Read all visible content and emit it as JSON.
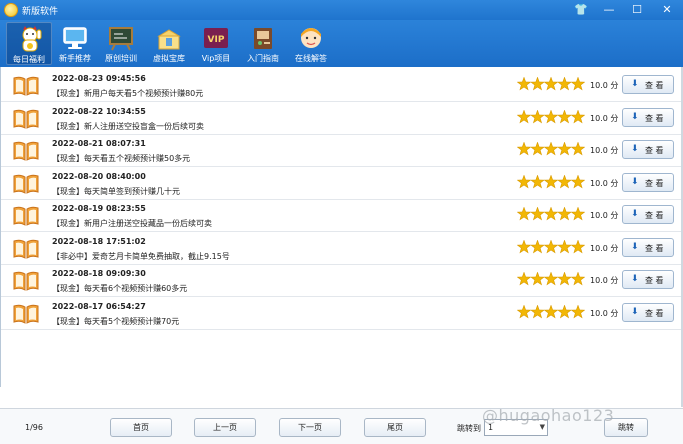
{
  "window": {
    "title": "新版软件",
    "min_glyph": "—",
    "max_glyph": "☐",
    "close_glyph": "✕",
    "skin_glyph": "👕"
  },
  "toolbar": {
    "items": [
      {
        "label": "每日福利",
        "icon": "lucky-cat-icon",
        "active": true
      },
      {
        "label": "新手推荐",
        "icon": "monitor-icon"
      },
      {
        "label": "原创培训",
        "icon": "blackboard-icon"
      },
      {
        "label": "虚拟宝库",
        "icon": "treasure-box-icon"
      },
      {
        "label": "Vip项目",
        "icon": "vip-icon"
      },
      {
        "label": "入门指南",
        "icon": "guide-book-icon"
      },
      {
        "label": "在线解答",
        "icon": "support-agent-icon"
      }
    ],
    "vip_text": "VIP"
  },
  "list": {
    "view_label": "查 看",
    "score_label": "10.0 分",
    "stars": 5,
    "rows": [
      {
        "date": "2022-08-23 09:45:56",
        "title": "【现金】新用户每天看5个视频预计赚80元"
      },
      {
        "date": "2022-08-22 10:34:55",
        "title": "【现金】新人注册送空投盲盒一份后续可卖"
      },
      {
        "date": "2022-08-21 08:07:31",
        "title": "【现金】每天看五个视频预计赚50多元"
      },
      {
        "date": "2022-08-20 08:40:00",
        "title": "【现金】每天简单签到预计赚几十元"
      },
      {
        "date": "2022-08-19 08:23:55",
        "title": "【现金】新用户注册送空投藏品一份后续可卖"
      },
      {
        "date": "2022-08-18 17:51:02",
        "title": "【非必中】爱奇艺月卡简单免费抽取，截止9.15号"
      },
      {
        "date": "2022-08-18 09:09:30",
        "title": "【现金】每天看6个视频预计赚60多元"
      },
      {
        "date": "2022-08-17 06:54:27",
        "title": "【现金】每天看5个视频预计赚70元"
      }
    ]
  },
  "footer": {
    "page_info": "1/96",
    "first": "首页",
    "prev": "上一页",
    "next": "下一页",
    "last": "尾页",
    "jump_label": "跳转到",
    "jump_value": "1",
    "go": "跳转"
  },
  "watermark": "@hugaohao123",
  "colors": {
    "titlebar": "#2f86dc",
    "toolbar": "#1c6ec8",
    "star": "#f2b705",
    "link_arrow": "#1d64b8"
  }
}
